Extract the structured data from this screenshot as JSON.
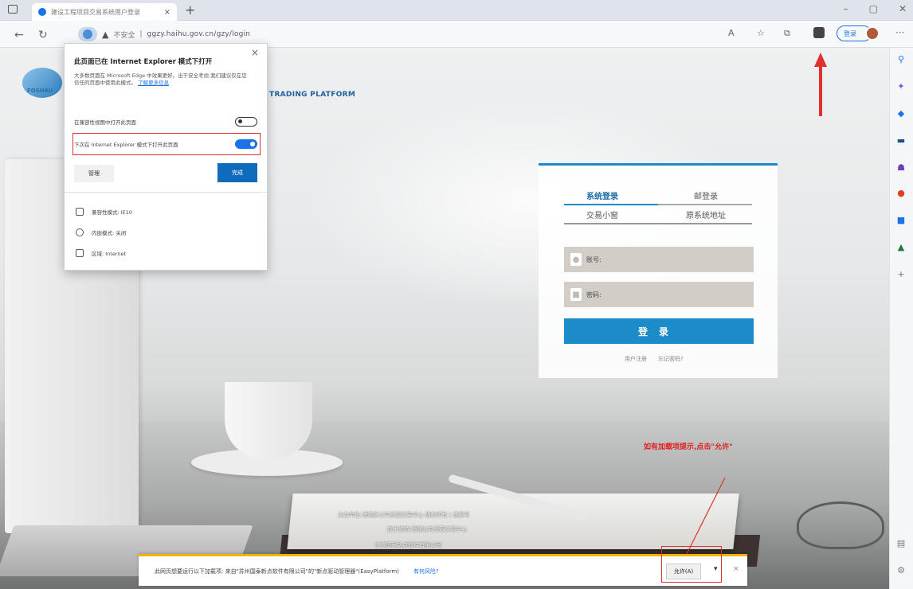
{
  "browser": {
    "tab_title": "建设工程项目交易系统用户登录",
    "tab_close": "×",
    "new_tab": "+",
    "win_min": "–",
    "win_max": "▢",
    "win_close": "✕",
    "security_label": "不安全",
    "url": "ggzy.haihu.gov.cn/gzy/login",
    "signin_label": "登录",
    "more": "···"
  },
  "page": {
    "logo_text": "FOSHAU",
    "platform_en": "TRADING PLATFORM"
  },
  "login": {
    "tabs": [
      {
        "label": "系统登录"
      },
      {
        "label": "邮登录"
      },
      {
        "label": "交易小窗"
      },
      {
        "label": "原系统地址"
      }
    ],
    "account_placeholder": "账号:",
    "password_placeholder": "密码:",
    "login_button": "登录",
    "link_register": "用户注册",
    "link_forgot": "忘记密码?"
  },
  "footer": {
    "line1": "主办单位:海曙区公共资源交易中心 版权所有 | 备案号",
    "line2": "技术支持:海曙公共资源交易中心",
    "line3": "江苏国泰新点软件有限公司"
  },
  "ie_popup": {
    "title": "此页面已在 Internet Explorer 模式下打开",
    "description": "大多数页面在 Microsoft Edge 中效果更好。出于安全考虑,我们建议仅在您信任的页面中使用此模式。",
    "learn_more": "了解更多信息",
    "row1_label": "在兼容性视图中打开此页面",
    "row2_label": "下次在 Internet Explorer 模式下打开此页面",
    "manage_button": "管理",
    "done_button": "完成",
    "info1": "兼容性模式: IE10",
    "info2": "内嵌模式: 关闭",
    "info3": "区域: Internet"
  },
  "annotations": {
    "hint_text": "如有加载项提示,点击\"允许\""
  },
  "notification": {
    "message": "此网页想要运行以下加载项: 来自\"苏州国泰新点软件有限公司\"的\"新点驱动管理器\"(EasyPlatform)",
    "link": "有何风险?",
    "allow_button": "允许(A)",
    "caret": "▾",
    "close": "×"
  },
  "colors": {
    "accent": "#1b8cc8",
    "annotation_red": "#e03030",
    "edge_blue": "#1a73e8"
  },
  "icons": {
    "sidebar": [
      "search-icon",
      "sparkle-icon",
      "tag-icon",
      "briefcase-icon",
      "person-icon",
      "office-icon",
      "outlook-icon",
      "tree-icon",
      "add-icon",
      "layout-icon",
      "settings-icon"
    ]
  }
}
